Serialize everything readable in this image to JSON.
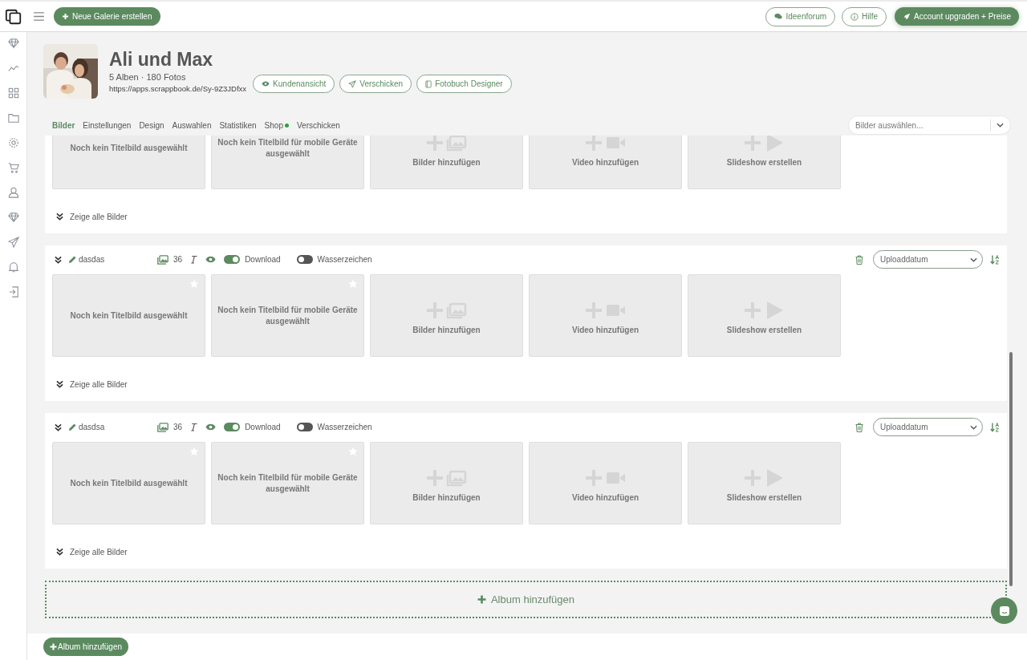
{
  "topbar": {
    "new_gallery": "Neue Galerie erstellen",
    "buttons": [
      {
        "label": "Ideenforum",
        "kind": "forum"
      },
      {
        "label": "Hilfe",
        "kind": "help"
      },
      {
        "label": "Account upgraden + Preise",
        "kind": "upgrade"
      }
    ]
  },
  "sidebar": {
    "items": [
      {
        "kind": "diamond"
      },
      {
        "kind": "chart"
      },
      {
        "kind": "grid"
      },
      {
        "kind": "folder"
      },
      {
        "kind": "gear"
      },
      {
        "kind": "cart"
      },
      {
        "kind": "user"
      },
      {
        "kind": "diamond"
      },
      {
        "kind": "send"
      },
      {
        "kind": "bell"
      },
      {
        "kind": "logout"
      }
    ]
  },
  "gallery": {
    "title": "Ali und Max",
    "stats": "5 Alben · 180 Fotos",
    "url": "https://apps.scrappbook.de/Sy-9Z3JDfxx",
    "actions": [
      {
        "label": "Kundenansicht",
        "kind": "view"
      },
      {
        "label": "Verschicken",
        "kind": "send"
      },
      {
        "label": "Fotobuch Designer",
        "kind": "book"
      }
    ]
  },
  "tabs": [
    {
      "label": "Bilder",
      "selected": true,
      "dot": false
    },
    {
      "label": "Einstellungen",
      "selected": false,
      "dot": false
    },
    {
      "label": "Design",
      "selected": false,
      "dot": false
    },
    {
      "label": "Auswahlen",
      "selected": false,
      "dot": false
    },
    {
      "label": "Statistiken",
      "selected": false,
      "dot": false
    },
    {
      "label": "Shop",
      "selected": false,
      "dot": true
    },
    {
      "label": "Verschicken",
      "selected": false,
      "dot": false
    }
  ],
  "image_select": {
    "placeholder": "Bilder auswählen..."
  },
  "albums": [
    {
      "tiles": [
        {
          "kind": "cover",
          "star": false,
          "label": "Noch kein Titelbild ausgewählt"
        },
        {
          "kind": "cover",
          "star": false,
          "label": "Noch kein Titelbild für mobile Geräte ausgewählt"
        },
        {
          "kind": "images",
          "label": "Bilder hinzufügen"
        },
        {
          "kind": "video",
          "label": "Video hinzufügen"
        },
        {
          "kind": "slideshow",
          "label": "Slideshow erstellen"
        }
      ],
      "show_all": "Zeige alle Bilder"
    },
    {
      "name": "dasdas",
      "count": "36",
      "download": true,
      "watermark": false,
      "download_label": "Download",
      "watermark_label": "Wasserzeichen",
      "sort": "Uploaddatum",
      "tiles": [
        {
          "kind": "cover",
          "star": true,
          "label": "Noch kein Titelbild ausgewählt"
        },
        {
          "kind": "cover",
          "star": true,
          "label": "Noch kein Titelbild für mobile Geräte ausgewählt"
        },
        {
          "kind": "images",
          "label": "Bilder hinzufügen"
        },
        {
          "kind": "video",
          "label": "Video hinzufügen"
        },
        {
          "kind": "slideshow",
          "label": "Slideshow erstellen"
        }
      ],
      "show_all": "Zeige alle Bilder"
    },
    {
      "name": "dasdsa",
      "count": "36",
      "download": true,
      "watermark": false,
      "download_label": "Download",
      "watermark_label": "Wasserzeichen",
      "sort": "Uploaddatum",
      "tiles": [
        {
          "kind": "cover",
          "star": true,
          "label": "Noch kein Titelbild ausgewählt"
        },
        {
          "kind": "cover",
          "star": true,
          "label": "Noch kein Titelbild für mobile Geräte ausgewählt"
        },
        {
          "kind": "images",
          "label": "Bilder hinzufügen"
        },
        {
          "kind": "video",
          "label": "Video hinzufügen"
        },
        {
          "kind": "slideshow",
          "label": "Slideshow erstellen"
        }
      ],
      "show_all": "Zeige alle Bilder"
    }
  ],
  "add_album": "Album hinzufügen",
  "footer": {
    "add_album": "Album hinzufügen"
  }
}
